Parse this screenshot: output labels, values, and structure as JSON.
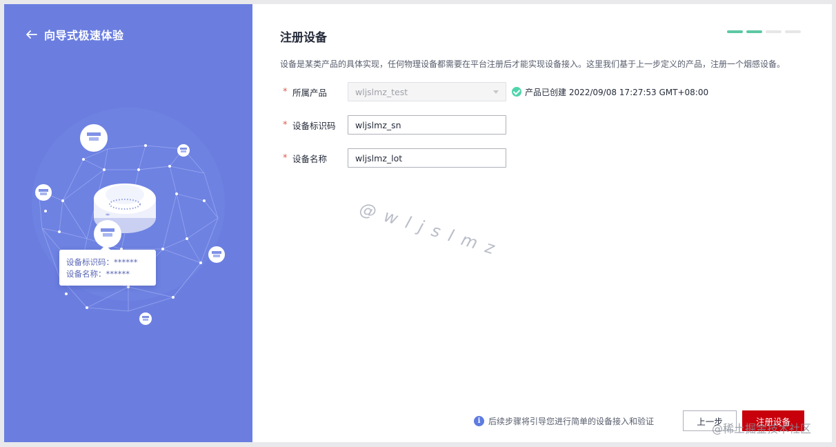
{
  "left_panel": {
    "back_label": "向导式极速体验",
    "tooltip": {
      "line1": "设备标识码：******",
      "line2": "设备名称：******"
    }
  },
  "main": {
    "title": "注册设备",
    "steps": [
      true,
      true,
      false,
      false
    ],
    "description": "设备是某类产品的具体实现，任何物理设备都需要在平台注册后才能实现设备接入。这里我们基于上一步定义的产品，注册一个烟感设备。",
    "form": {
      "product": {
        "required_mark": "*",
        "label": "所属产品",
        "value": "wljslmz_test",
        "status": "产品已创建 2022/09/08 17:27:53 GMT+08:00"
      },
      "device_id": {
        "required_mark": "*",
        "label": "设备标识码",
        "value": "wljslmz_sn"
      },
      "device_name": {
        "required_mark": "*",
        "label": "设备名称",
        "value": "wljslmz_lot"
      }
    },
    "watermark": "@wljslmz"
  },
  "footer": {
    "tip": "后续步骤将引导您进行简单的设备接入和验证",
    "prev_label": "上一步",
    "submit_label": "注册设备",
    "site_watermark": "@稀土掘金技术社区"
  },
  "colors": {
    "left_bg": "#6b7ee0",
    "step_active": "#5cc8a5",
    "primary": "#c7000b",
    "required": "#e05b4c"
  }
}
